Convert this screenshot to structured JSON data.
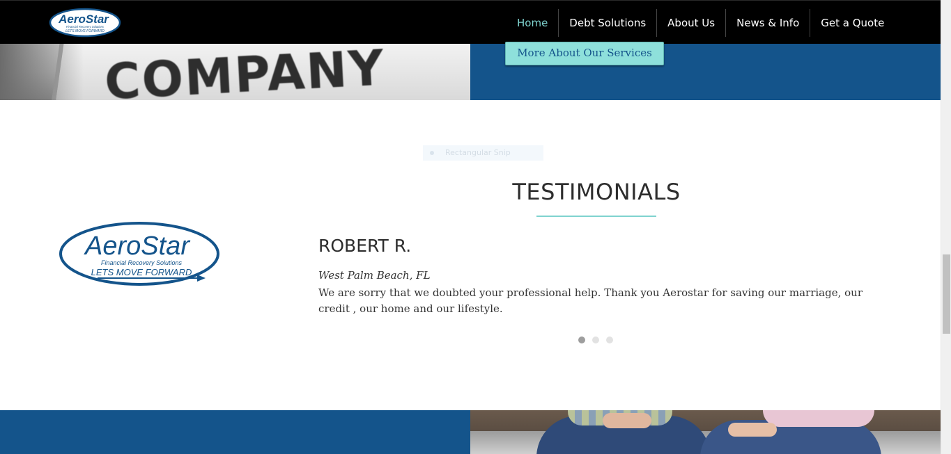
{
  "header": {
    "logo": {
      "name": "AeroStar",
      "subtitle": "Financial Recovery Solutions",
      "tagline": "LETS MOVE FORWARD"
    },
    "nav": [
      {
        "label": "Home",
        "active": true
      },
      {
        "label": "Debt Solutions",
        "active": false
      },
      {
        "label": "About Us",
        "active": false
      },
      {
        "label": "News & Info",
        "active": false
      },
      {
        "label": "Get a Quote",
        "active": false
      }
    ]
  },
  "services_band": {
    "photo_text": "COMPANY",
    "button_label": "More About Our Services"
  },
  "snip_overlay": {
    "label": "Rectangular Snip"
  },
  "testimonials": {
    "title": "TESTIMONIALS",
    "logo": {
      "name": "AeroStar",
      "subtitle": "Financial Recovery Solutions",
      "tagline": "LETS MOVE FORWARD"
    },
    "current": {
      "name": "ROBERT R.",
      "location": "West Palm Beach, FL",
      "quote": "We are sorry that we doubted your professional help. Thank you Aerostar for saving our marriage, our credit , our home and our lifestyle."
    },
    "slides": 3,
    "active_slide": 1
  },
  "colors": {
    "brand_blue": "#14548b",
    "accent_teal": "#7fd3cf",
    "header_bg": "#000000"
  }
}
